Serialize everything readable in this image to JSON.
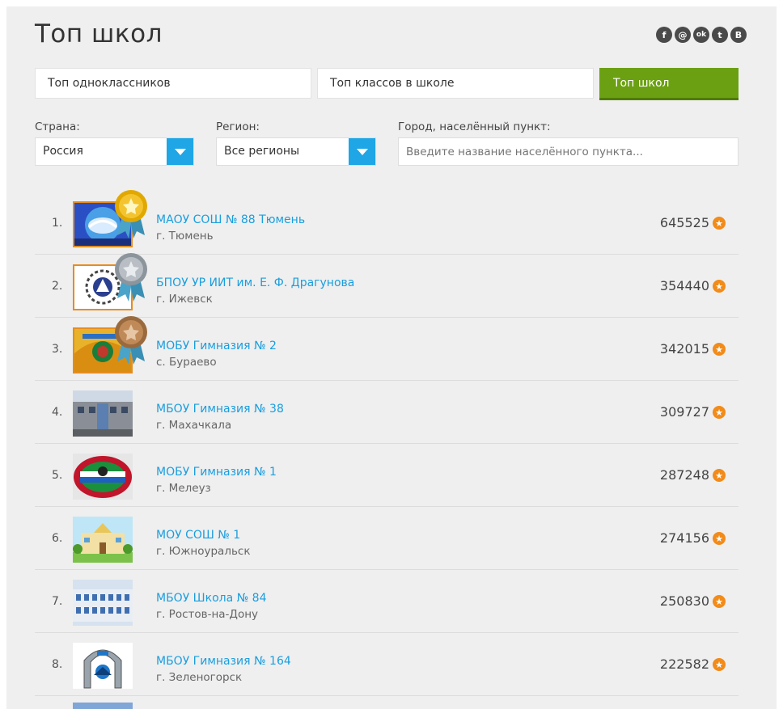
{
  "page": {
    "title": "Топ школ"
  },
  "social": {
    "icons": [
      "facebook-icon",
      "mail-ru-icon",
      "odnoklassniki-icon",
      "twitter-icon",
      "vkontakte-icon"
    ],
    "glyphs": [
      "f",
      "@",
      "ok",
      "t",
      "B"
    ]
  },
  "tabs": [
    {
      "label": "Топ одноклассников",
      "active": false
    },
    {
      "label": "Топ классов в школе",
      "active": false
    },
    {
      "label": "Топ школ",
      "active": true
    }
  ],
  "filters": {
    "country_label": "Страна:",
    "country_value": "Россия",
    "region_label": "Регион:",
    "region_value": "Все регионы",
    "city_label": "Город, населённый пункт:",
    "city_placeholder": "Введите название населённого пункта..."
  },
  "colors": {
    "accent_green": "#6ba012",
    "link_blue": "#1a9ede",
    "select_arrow_blue": "#1ea6e6",
    "star_orange": "#f28b19"
  },
  "schools": [
    {
      "rank": "1.",
      "name": "МАОУ СОШ № 88 Тюмень",
      "city": "г. Тюмень",
      "score": "645525",
      "medal": "gold"
    },
    {
      "rank": "2.",
      "name": "БПОУ УР ИИТ им. Е. Ф. Драгунова",
      "city": "г. Ижевск",
      "score": "354440",
      "medal": "silver"
    },
    {
      "rank": "3.",
      "name": "МОБУ Гимназия № 2",
      "city": "с. Бураево",
      "score": "342015",
      "medal": "bronze"
    },
    {
      "rank": "4.",
      "name": "МБОУ Гимназия № 38",
      "city": "г. Махачкала",
      "score": "309727",
      "medal": ""
    },
    {
      "rank": "5.",
      "name": "МОБУ Гимназия № 1",
      "city": "г. Мелеуз",
      "score": "287248",
      "medal": ""
    },
    {
      "rank": "6.",
      "name": "МОУ СОШ № 1",
      "city": "г. Южноуральск",
      "score": "274156",
      "medal": ""
    },
    {
      "rank": "7.",
      "name": "МБОУ Школа № 84",
      "city": "г. Ростов-на-Дону",
      "score": "250830",
      "medal": ""
    },
    {
      "rank": "8.",
      "name": "МБОУ Гимназия № 164",
      "city": "г. Зеленогорск",
      "score": "222582",
      "medal": ""
    }
  ]
}
